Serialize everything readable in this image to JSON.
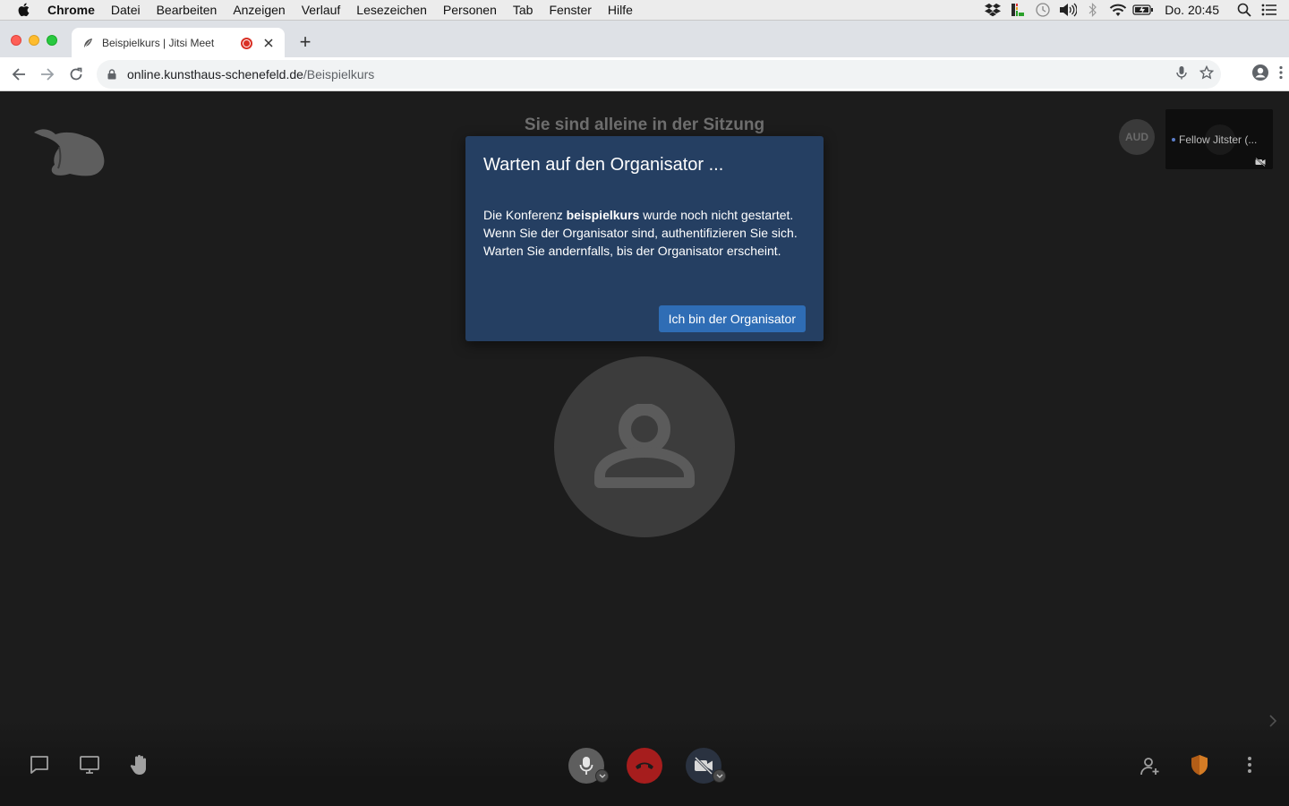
{
  "menubar": {
    "app_name": "Chrome",
    "menus": [
      "Datei",
      "Bearbeiten",
      "Anzeigen",
      "Verlauf",
      "Lesezeichen",
      "Personen",
      "Tab",
      "Fenster",
      "Hilfe"
    ],
    "clock": "Do. 20:45",
    "status_icons": [
      "dropbox-icon",
      "battery-monitor-icon",
      "time-machine-icon",
      "volume-icon",
      "bluetooth-icon",
      "wifi-icon",
      "battery-icon"
    ]
  },
  "browser": {
    "tab_title": "Beispielkurs | Jitsi Meet",
    "new_tab_label": "+",
    "url_host": "online.kunsthaus-schenefeld.de",
    "url_path": "/Beispielkurs"
  },
  "meeting": {
    "alone_text": "Sie sind alleine in der Sitzung",
    "aud_label": "AUD",
    "participant_name": "Fellow Jitster (...",
    "dialog": {
      "title": "Warten auf den Organisator ...",
      "body_prefix": "Die Konferenz ",
      "room_name": "beispielkurs",
      "body_suffix": " wurde noch nicht gestartet. Wenn Sie der Organisator sind, authentifizieren Sie sich. Warten Sie andernfalls, bis der Organisator erscheint.",
      "button_label": "Ich bin der Organisator"
    }
  },
  "colors": {
    "dialog_bg": "#253f62",
    "primary_button": "#2f6db5",
    "hangup": "#a61d1d",
    "stage_bg": "#1c1c1c"
  }
}
